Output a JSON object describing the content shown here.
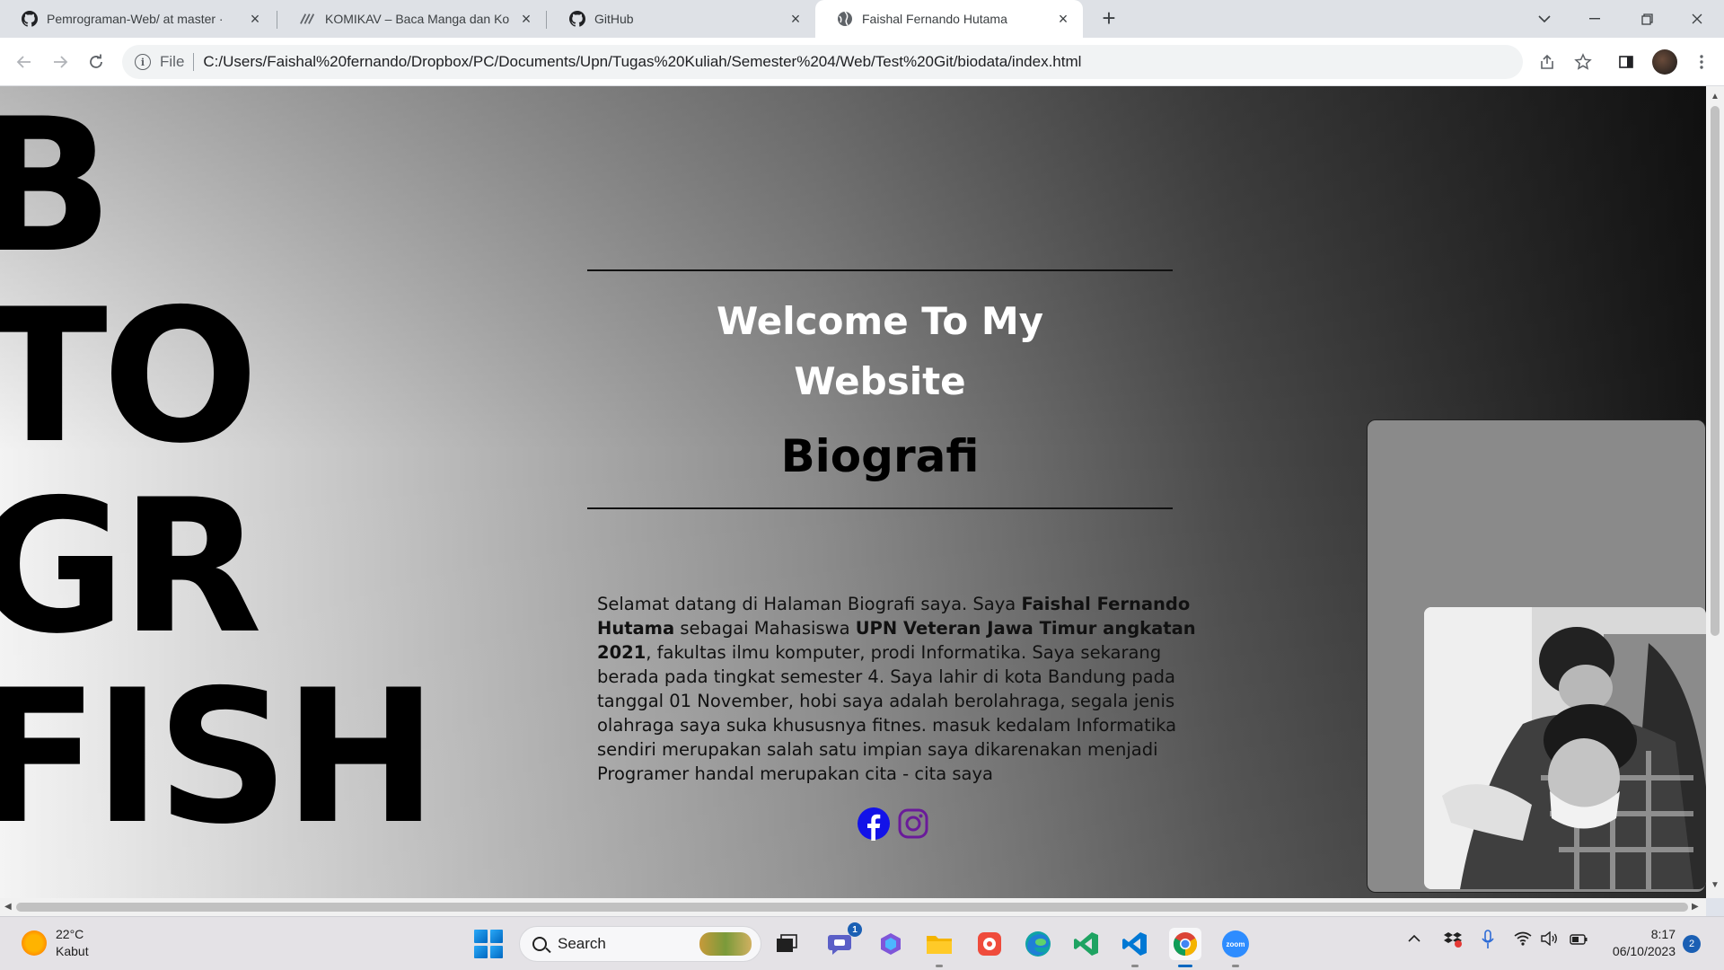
{
  "browser": {
    "tabs": [
      {
        "title": "Pemrograman-Web/ at master ·",
        "icon": "github-icon",
        "active": false
      },
      {
        "title": "KOMIKAV – Baca Manga dan Ko",
        "icon": "komikav-icon",
        "active": false
      },
      {
        "title": "GitHub",
        "icon": "github-icon",
        "active": false
      },
      {
        "title": "Faishal Fernando Hutama",
        "icon": "globe-icon",
        "active": true
      }
    ],
    "address": {
      "scheme": "File",
      "url": "C:/Users/Faishal%20fernando/Dropbox/PC/Documents/Upn/Tugas%20Kuliah/Semester%204/Web/Test%20Git/biodata/index.html"
    }
  },
  "page": {
    "big_words": [
      "B",
      "TO",
      "GR",
      "FISH"
    ],
    "welcome_line1": "Welcome To My",
    "welcome_line2": "Website",
    "heading": "Biografi",
    "paragraph": {
      "p1": "Selamat datang di Halaman Biografi saya. Saya ",
      "name": "Faishal Fernando Hutama",
      "p2": " sebagai Mahasiswa ",
      "uni": "UPN Veteran Jawa Timur angkatan 2021",
      "p3": ", fakultas ilmu komputer, prodi Informatika. Saya sekarang berada pada tingkat semester 4. Saya lahir di kota Bandung pada tanggal 01 November, hobi saya adalah berolahraga, segala jenis olahraga saya suka khususnya fitnes. masuk kedalam Informatika sendiri merupakan salah satu impian saya dikarenakan menjadi Programer handal merupakan cita - cita saya"
    },
    "social": [
      {
        "name": "facebook-icon",
        "color": "#1212e8"
      },
      {
        "name": "instagram-icon",
        "color": "#6a1b9a"
      }
    ]
  },
  "taskbar": {
    "weather_temp": "22°C",
    "weather_desc": "Kabut",
    "search_label": "Search",
    "teams_badge": "1",
    "time": "8:17",
    "date": "06/10/2023",
    "notification_count": "2"
  }
}
